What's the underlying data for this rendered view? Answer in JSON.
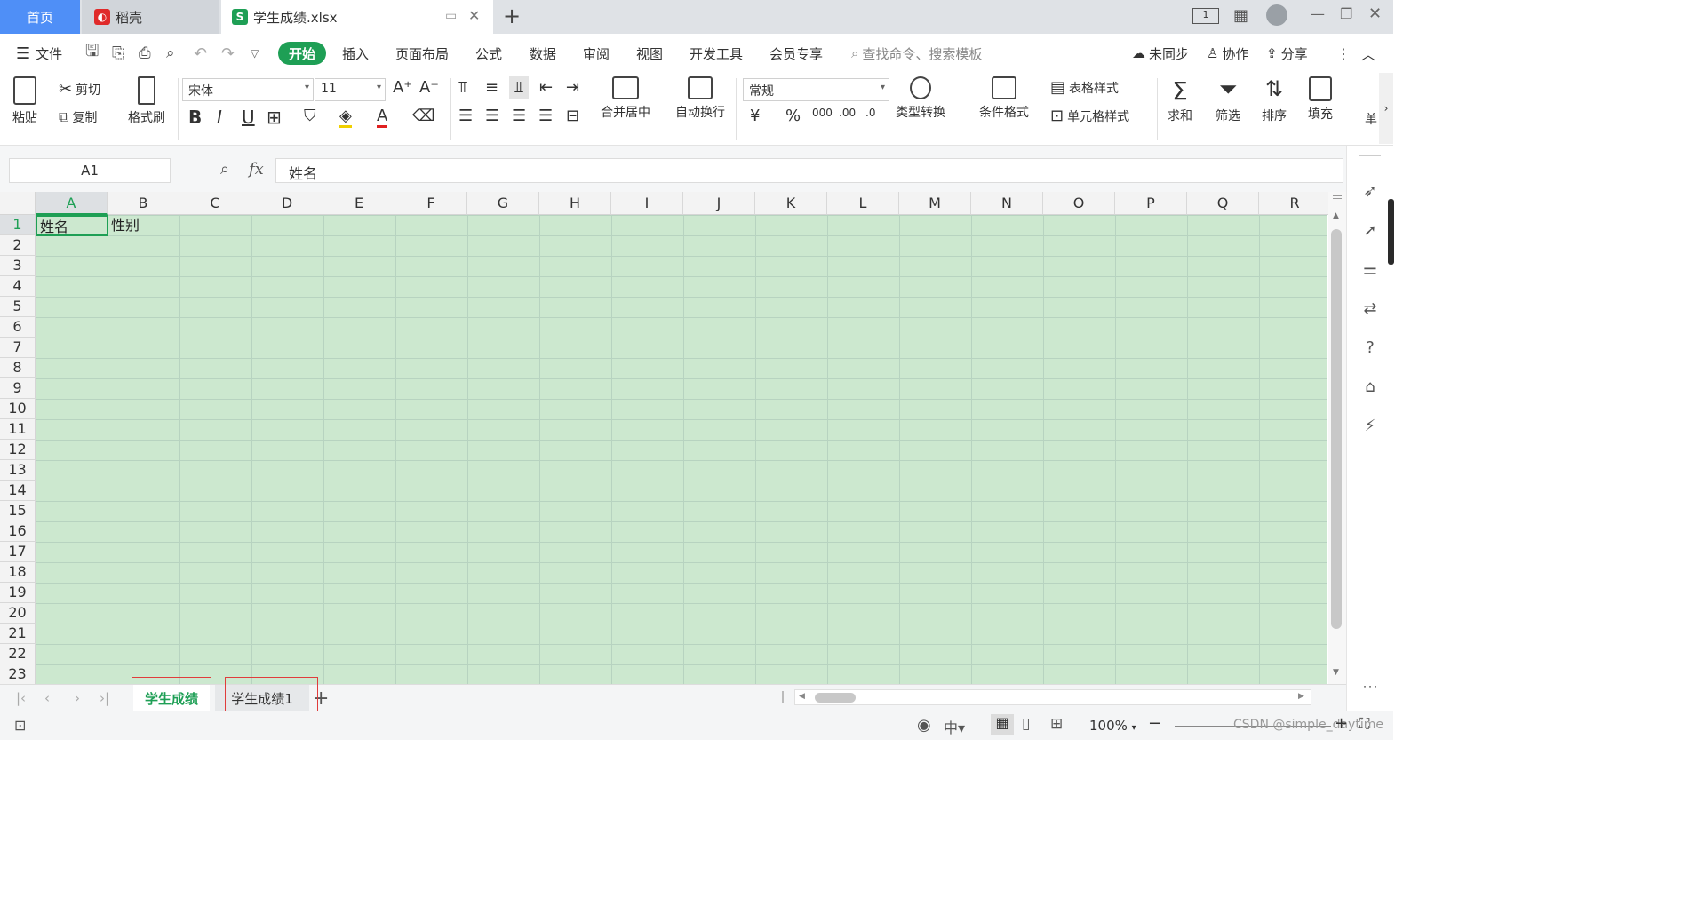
{
  "tabs": {
    "home": "首页",
    "daoke": "稻壳",
    "file": "学生成绩.xlsx",
    "file_icon": "S",
    "new_tab": "+"
  },
  "menu": {
    "file": "文件",
    "items": [
      "开始",
      "插入",
      "页面布局",
      "公式",
      "数据",
      "审阅",
      "视图",
      "开发工具",
      "会员专享"
    ],
    "search": "查找命令、搜索模板",
    "unsynced": "未同步",
    "collab": "协作",
    "share": "分享"
  },
  "ribbon": {
    "paste": "粘贴",
    "cut": "剪切",
    "copy": "复制",
    "format_painter": "格式刷",
    "font_name": "宋体",
    "font_size": "11",
    "merge": "合并居中",
    "wrap": "自动换行",
    "number_format": "常规",
    "type_convert": "类型转换",
    "cond_format": "条件格式",
    "table_style": "表格样式",
    "cell_style": "单元格样式",
    "sum": "求和",
    "filter": "筛选",
    "sort": "排序",
    "fill": "填充",
    "single": "单"
  },
  "formula": {
    "cell_ref": "A1",
    "fx": "fx",
    "value": "姓名"
  },
  "grid": {
    "columns": [
      "A",
      "B",
      "C",
      "D",
      "E",
      "F",
      "G",
      "H",
      "I",
      "J",
      "K",
      "L",
      "M",
      "N",
      "O",
      "P",
      "Q",
      "R"
    ],
    "rows": [
      "1",
      "2",
      "3",
      "4",
      "5",
      "6",
      "7",
      "8",
      "9",
      "10",
      "11",
      "12",
      "13",
      "14",
      "15",
      "16",
      "17",
      "18",
      "19",
      "20",
      "21",
      "22",
      "23"
    ],
    "a1": "姓名",
    "b1": "性别"
  },
  "sheets": {
    "tab1": "学生成绩",
    "tab2": "学生成绩1",
    "add": "+"
  },
  "status": {
    "zoom": "100%",
    "watermark": "CSDN @simple_daytime"
  },
  "colors": {
    "accent": "#1e9f55",
    "grid_bg": "#cce8cf",
    "home_tab": "#4f8ff7",
    "highlight_box": "#e03c3c"
  }
}
